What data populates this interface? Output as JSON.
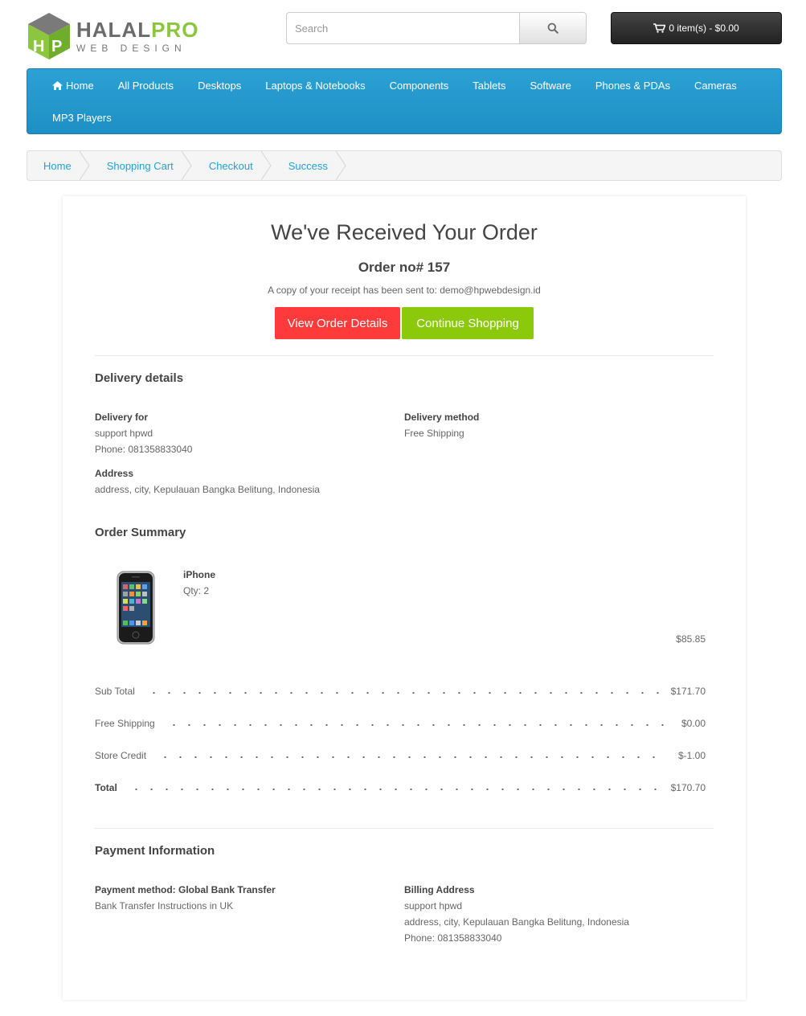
{
  "brand": {
    "name_part1": "HALAL",
    "name_part2": "PRO",
    "tagline": "WEB DESIGN"
  },
  "search": {
    "placeholder": "Search"
  },
  "cart": {
    "label": "0 item(s) - $0.00"
  },
  "nav": {
    "row1": [
      "Home",
      "All Products",
      "Desktops",
      "Laptops & Notebooks",
      "Components",
      "Tablets",
      "Software",
      "Phones & PDAs",
      "Cameras"
    ],
    "row2": [
      "MP3 Players"
    ]
  },
  "breadcrumb": [
    "Home",
    "Shopping Cart",
    "Checkout",
    "Success"
  ],
  "confirmation": {
    "title": "We've Received Your Order",
    "order_no": "Order no# 157",
    "copy_text": "A copy of your receipt has been sent to: demo@hpwebdesign.id",
    "view_button": "View Order Details",
    "continue_button": "Continue Shopping"
  },
  "delivery": {
    "heading": "Delivery details",
    "for_label": "Delivery for",
    "for_name": "support hpwd",
    "for_phone": "Phone: 081358833040",
    "method_label": "Delivery method",
    "method_value": "Free Shipping",
    "address_label": "Address",
    "address_value": "address, city, Kepulauan Bangka Belitung, Indonesia"
  },
  "summary": {
    "heading": "Order Summary",
    "product": {
      "name": "iPhone",
      "qty": "Qty: 2",
      "price": "$85.85"
    },
    "rows": [
      {
        "label": "Sub Total",
        "amount": "$171.70"
      },
      {
        "label": "Free Shipping",
        "amount": "$0.00"
      },
      {
        "label": "Store Credit",
        "amount": "$-1.00"
      },
      {
        "label": "Total",
        "amount": "$170.70"
      }
    ]
  },
  "payment": {
    "heading": "Payment Information",
    "method_label": "Payment method: Global Bank Transfer",
    "method_value": "Bank Transfer Instructions in UK",
    "billing_label": "Billing Address",
    "billing_name": "support hpwd",
    "billing_address": "address, city, Kepulauan Bangka Belitung, Indonesia",
    "billing_phone": "Phone: 081358833040"
  },
  "colors": {
    "nav": "#2ba1d4",
    "link": "#23a1d1",
    "red_button": "#ff3a3a",
    "green_button": "#8cc90a",
    "brand_green": "#8cc63f"
  }
}
